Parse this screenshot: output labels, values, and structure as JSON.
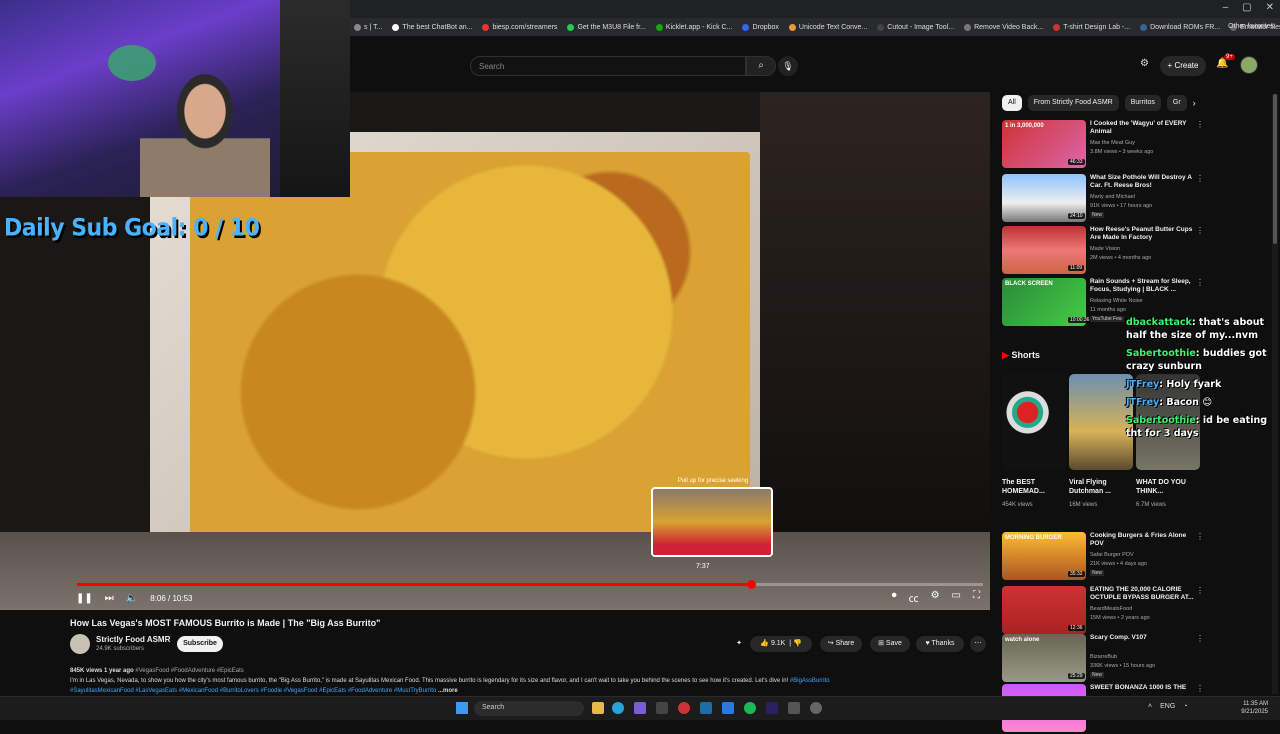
{
  "bookmarks": [
    "s | T...",
    "The best ChatBot an...",
    "biesp.com/streamers",
    "Get the M3U8 File fr...",
    "Kicklet.app - Kick C...",
    "Dropbox",
    "Unicode Text Conve...",
    "Cutout - Image Tool...",
    "Remove Video Back...",
    "T-shirt Design Lab -...",
    "Download ROMs FR...",
    "Emulator files - Emu..."
  ],
  "bookmarks_other": "Other favorites",
  "overlay": {
    "sub_goal": "Daily Sub Goal:  0 / 10"
  },
  "header": {
    "search_placeholder": "Search",
    "create_label": "Create",
    "notif_count": "9+"
  },
  "player": {
    "time": "8:06 / 10:53",
    "progress": 0.744,
    "preview_hint": "Pull up for precise seeking",
    "preview_time": "7:37"
  },
  "video": {
    "title": "How Las Vegas's MOST FAMOUS Burrito is Made | The \"Big Ass Burrito\"",
    "channel": "Strictly Food ASMR",
    "subs": "24.9K subscribers",
    "subscribe": "Subscribe",
    "likes": "9.1K",
    "share": "Share",
    "save": "Save",
    "thanks": "Thanks",
    "views_line": "845K views  1 year ago",
    "hashtags": "#VegasFood #FoodAdventure #EpicEats",
    "description": "I'm in Las Vegas, Nevada, to show you how the city's most famous burrito, the \"Big Ass Burrito,\" is made at Sayulitas Mexican Food. This massive burrito is legendary for its size and flavor, and I can't wait to take you behind the scenes to see how it's created. Let's dive in!",
    "desc_tag1": "#BigAssBurrito",
    "desc_tags2": "#SayulitasMexicanFood #LasVegasEats #MexicanFood #BurritoLovers #Foodie #VegasFood #EpicEats #FoodAdventure #MustTryBurrito",
    "more": "...more"
  },
  "chips": [
    "All",
    "From Strictly Food ASMR",
    "Burritos",
    "Gr"
  ],
  "recommendations": [
    {
      "title": "I Cooked the 'Wagyu' of EVERY Animal",
      "channel": "Max the Meat Guy",
      "views": "3.8M views • 3 weeks ago",
      "duration": "46:33",
      "badge": "",
      "thumb_text": "1 in 3,000,000"
    },
    {
      "title": "What Size Pothole Will Destroy A Car. Ft. Reese Bros!",
      "channel": "Marty and Michael",
      "views": "91K views • 17 hours ago",
      "duration": "24:10",
      "badge": "New",
      "thumb_text": ""
    },
    {
      "title": "How Reese's Peanut Butter Cups Are Made In Factory",
      "channel": "Made Vision",
      "views": "2M views • 4 months ago",
      "duration": "11:09",
      "badge": "",
      "thumb_text": ""
    },
    {
      "title": "Rain Sounds + Stream for Sleep, Focus, Studying | BLACK ...",
      "channel": "Relaxing White Noise",
      "views": "11 months ago",
      "duration": "10:00:36",
      "badge": "YouTube Fea",
      "thumb_text": "BLACK SCREEN"
    },
    {
      "title": "Cooking Burgers & Fries Alone POV",
      "channel": "Safai Burger POV",
      "views": "21K views • 4 days ago",
      "duration": "35:32",
      "badge": "New",
      "thumb_text": "MORNING BURGER"
    },
    {
      "title": "EATING THE 20,000 CALORIE OCTUPLE BYPASS BURGER AT...",
      "channel": "BeardMeatsFood",
      "views": "15M views • 2 years ago",
      "duration": "12:36",
      "badge": "",
      "thumb_text": ""
    },
    {
      "title": "Scary Comp. V107",
      "channel": "BizarreBub",
      "views": "336K views • 15 hours ago",
      "duration": "25:29",
      "badge": "New",
      "thumb_text": "watch alone"
    },
    {
      "title": "SWEET BONANZA 1000 IS THE",
      "channel": "",
      "views": "",
      "duration": "",
      "badge": "",
      "thumb_text": ""
    }
  ],
  "shorts": {
    "heading": "Shorts",
    "items": [
      {
        "title": "The BEST HOMEMAD...",
        "views": "454K views"
      },
      {
        "title": "Viral Flying Dutchman ...",
        "views": "16M views"
      },
      {
        "title": "WHAT DO YOU THINK...",
        "views": "6.7M views"
      }
    ]
  },
  "chat": [
    {
      "user": "dbackattack",
      "msg": ": that's about half the size of my...nvm"
    },
    {
      "user": "Sabertoothie",
      "msg": ": buddies got crazy sunburn"
    },
    {
      "user": "JTFrey",
      "msg": ": Holy fyark"
    },
    {
      "user": "JTFrey",
      "msg": ": Bacon 😊"
    },
    {
      "user": "Sabertoothie",
      "msg": ": id be eating tht for 3 days"
    }
  ],
  "taskbar": {
    "search": "Search",
    "lang": "ENG",
    "time": "11:35 AM",
    "date": "9/21/2025"
  },
  "colors": {
    "accent": "#ff0000",
    "subgoal": "#4ab3ff",
    "chat_user": "#3ff36a"
  }
}
